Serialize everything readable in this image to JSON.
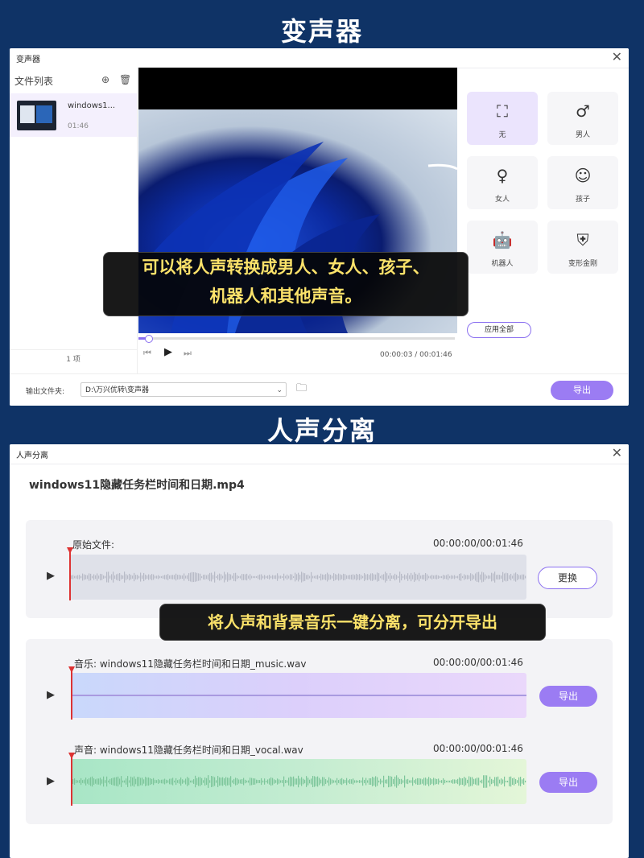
{
  "section1": {
    "title": "变声器"
  },
  "section2": {
    "title": "人声分离"
  },
  "voice_changer": {
    "window_title": "变声器",
    "file_list_title": "文件列表",
    "file": {
      "name": "windows1...",
      "duration": "01:46"
    },
    "item_count": "1 项",
    "player": {
      "time": "00:00:03 / 00:01:46",
      "progress": 0.03
    },
    "effects": [
      {
        "label": "无",
        "icon": "frame-icon",
        "active": true
      },
      {
        "label": "男人",
        "icon": "male-icon",
        "active": false
      },
      {
        "label": "女人",
        "icon": "female-icon",
        "active": false
      },
      {
        "label": "孩子",
        "icon": "child-face-icon",
        "active": false
      },
      {
        "label": "机器人",
        "icon": "robot-icon",
        "active": false
      },
      {
        "label": "变形金刚",
        "icon": "transformer-icon",
        "active": false
      }
    ],
    "apply_all": "应用全部",
    "output_label": "输出文件夹:",
    "output_path": "D:\\万兴优转\\变声器",
    "export": "导出",
    "caption_line1": "可以将人声转换成男人、女人、孩子、",
    "caption_line2": "机器人和其他声音。"
  },
  "vocal_separation": {
    "window_title": "人声分离",
    "file_title": "windows11隐藏任务栏时间和日期.mp4",
    "original": {
      "label": "原始文件:",
      "time": "00:00:00/00:01:46",
      "button": "更换"
    },
    "music": {
      "label": "音乐:   windows11隐藏任务栏时间和日期_music.wav",
      "time": "00:00:00/00:01:46",
      "button": "导出"
    },
    "vocal": {
      "label": "声音:   windows11隐藏任务栏时间和日期_vocal.wav",
      "time": "00:00:00/00:01:46",
      "button": "导出"
    },
    "caption": "将人声和背景音乐一键分离，可分开导出"
  },
  "colors": {
    "background": "#0f3366",
    "accent": "#9b7cf3",
    "caption_text": "#fbe26a",
    "playhead": "#dd3333"
  }
}
